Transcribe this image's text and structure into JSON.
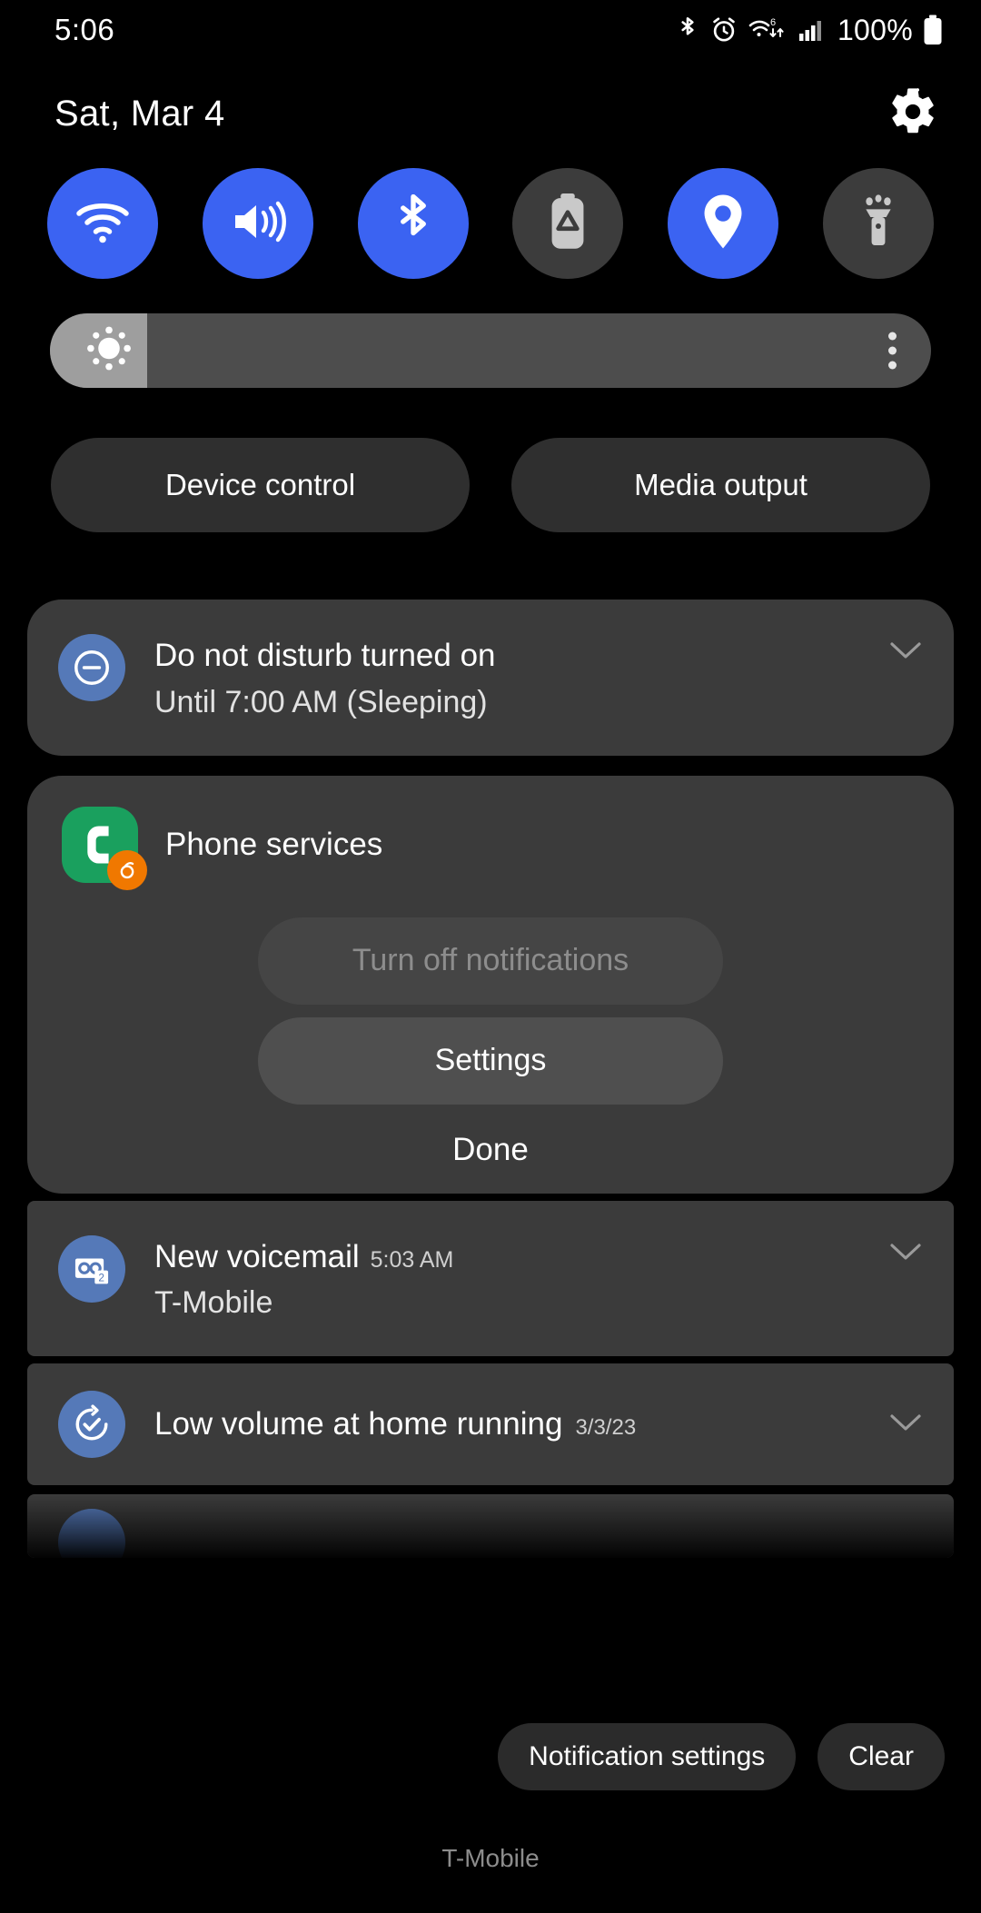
{
  "statusbar": {
    "clock": "5:06",
    "battery_percent": "100%",
    "icons": [
      "bluetooth-icon",
      "alarm-icon",
      "wifi-6-icon",
      "cellular-signal-icon",
      "battery-full-icon"
    ]
  },
  "header": {
    "date": "Sat, Mar 4",
    "settings_icon": "gear-icon"
  },
  "quick_settings": {
    "tiles": [
      {
        "name": "wifi",
        "icon": "wifi-icon",
        "state": "on"
      },
      {
        "name": "sound",
        "icon": "volume-icon",
        "state": "on"
      },
      {
        "name": "bluetooth",
        "icon": "bluetooth-icon",
        "state": "on"
      },
      {
        "name": "power-saving",
        "icon": "battery-saver-icon",
        "state": "off"
      },
      {
        "name": "location",
        "icon": "location-pin-icon",
        "state": "on"
      },
      {
        "name": "flashlight",
        "icon": "flashlight-icon",
        "state": "off"
      }
    ],
    "accent_on": "#3b63f2",
    "tile_off": "#3c3c3c"
  },
  "brightness": {
    "icon": "brightness-sun-icon",
    "level_percent": 11,
    "menu_icon": "more-vertical-icon",
    "fill_color": "#9e9e9e",
    "track_color": "#4d4d4d"
  },
  "shortcuts": {
    "device_control": "Device control",
    "media_output": "Media output"
  },
  "notifications": [
    {
      "id": "dnd",
      "icon": "do-not-disturb-icon",
      "icon_bg": "#5579b8",
      "title": "Do not disturb turned on",
      "subtitle": "Until 7:00 AM (Sleeping)",
      "chevron": "chevron-down-icon"
    },
    {
      "id": "phone-services",
      "app_icon": "phone-app-icon",
      "app_badge_icon": "orange-badge-icon",
      "app_name": "Phone services",
      "action_turn_off": "Turn off notifications",
      "action_turn_off_enabled": false,
      "action_settings": "Settings",
      "action_done": "Done"
    },
    {
      "id": "voicemail",
      "icon": "voicemail-icon",
      "icon_bg": "#5579b8",
      "title": "New voicemail",
      "time": "5:03 AM",
      "subtitle": "T-Mobile",
      "chevron": "chevron-down-icon"
    },
    {
      "id": "routine",
      "icon": "routines-check-icon",
      "icon_bg": "#5579b8",
      "title": "Low volume at home running",
      "date": "3/3/23",
      "chevron": "chevron-down-icon"
    }
  ],
  "footer": {
    "notification_settings": "Notification settings",
    "clear": "Clear",
    "carrier": "T-Mobile"
  }
}
